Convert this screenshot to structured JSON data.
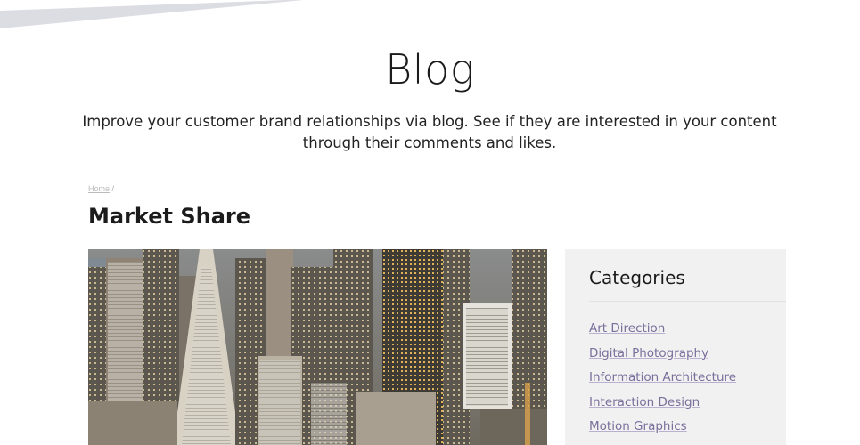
{
  "hero": {
    "title": "Blog",
    "subtitle": "Improve your customer brand relationships via blog. See if they are interested in your content through their comments and likes."
  },
  "breadcrumb": {
    "home_label": "Home",
    "separator": "/"
  },
  "post": {
    "title": "Market Share"
  },
  "sidebar": {
    "title": "Categories",
    "categories": [
      "Art Direction",
      "Digital Photography",
      "Information Architecture",
      "Interaction Design",
      "Motion Graphics"
    ]
  },
  "colors": {
    "link": "#7a6f9b",
    "sidebar_bg": "#f1f1f1",
    "text": "#1b1b1b"
  }
}
